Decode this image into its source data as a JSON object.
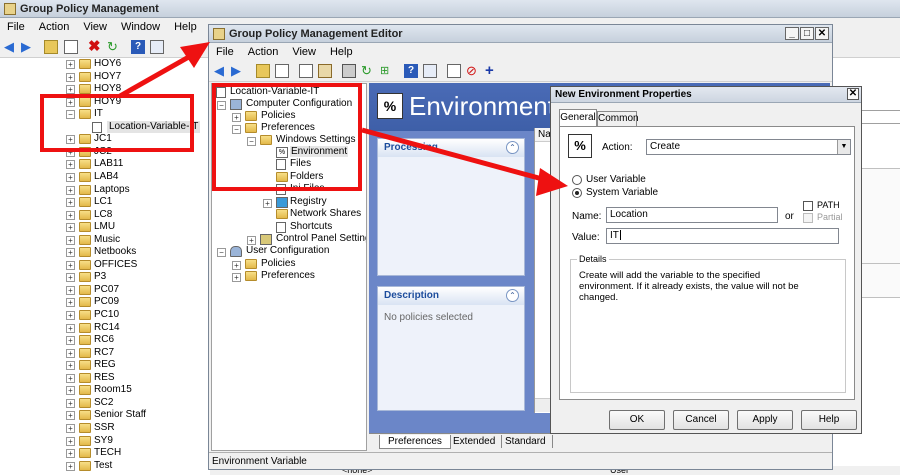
{
  "gpm": {
    "title": "Group Policy Management",
    "menu": [
      "File",
      "Action",
      "View",
      "Window",
      "Help"
    ],
    "tree": [
      "HOY6",
      "HOY7",
      "HOY8",
      "HOY9",
      "IT",
      "Location-Variable-IT",
      "JC1",
      "JC2",
      "LAB11",
      "LAB4",
      "Laptops",
      "LC1",
      "LC8",
      "LMU",
      "Music",
      "Netbooks",
      "OFFICES",
      "P3",
      "PC07",
      "PC09",
      "PC10",
      "RC14",
      "RC6",
      "RC7",
      "REG",
      "RES",
      "Room15",
      "SC2",
      "Senior Staff",
      "SSR",
      "SY9",
      "TECH",
      "Test"
    ]
  },
  "editor": {
    "title": "Group Policy Management Editor",
    "menu": [
      "File",
      "Action",
      "View",
      "Help"
    ],
    "tree": {
      "root": "Location-Variable-IT",
      "computer_config": "Computer Configuration",
      "policies": "Policies",
      "preferences": "Preferences",
      "windows_settings": "Windows Settings",
      "environment": "Environment",
      "files": "Files",
      "folders": "Folders",
      "ini_files": "Ini Files",
      "registry": "Registry",
      "network_shares": "Network Shares",
      "shortcuts": "Shortcuts",
      "control_panel": "Control Panel Settings",
      "user_config": "User Configuration",
      "user_policies": "Policies",
      "user_preferences": "Preferences"
    },
    "header": "Environment",
    "processing": "Processing",
    "description": "Description",
    "no_policies": "No policies selected",
    "name_col": "Nam",
    "tabs": [
      "Preferences",
      "Extended",
      "Standard"
    ],
    "status": "Environment Variable"
  },
  "dialog": {
    "title": "New Environment Properties",
    "tabs": [
      "General",
      "Common"
    ],
    "action_label": "Action:",
    "action_value": "Create",
    "user_variable": "User Variable",
    "system_variable": "System Variable",
    "name_label": "Name:",
    "name_value": "Location",
    "or": "or",
    "path": "PATH",
    "partial": "Partial",
    "value_label": "Value:",
    "value_value": "IT",
    "details_label": "Details",
    "details_text": "Create will add the variable to the specified environment. If it already exists, the value will not be changed.",
    "buttons": [
      "OK",
      "Cancel",
      "Apply",
      "Help"
    ]
  },
  "background": {
    "none_text": "<none>",
    "user_text": "User"
  },
  "colors": {
    "annotation": "#ee1111",
    "right_pane_bg": "#6b86c8",
    "header_bg": "#3e5fa8"
  }
}
